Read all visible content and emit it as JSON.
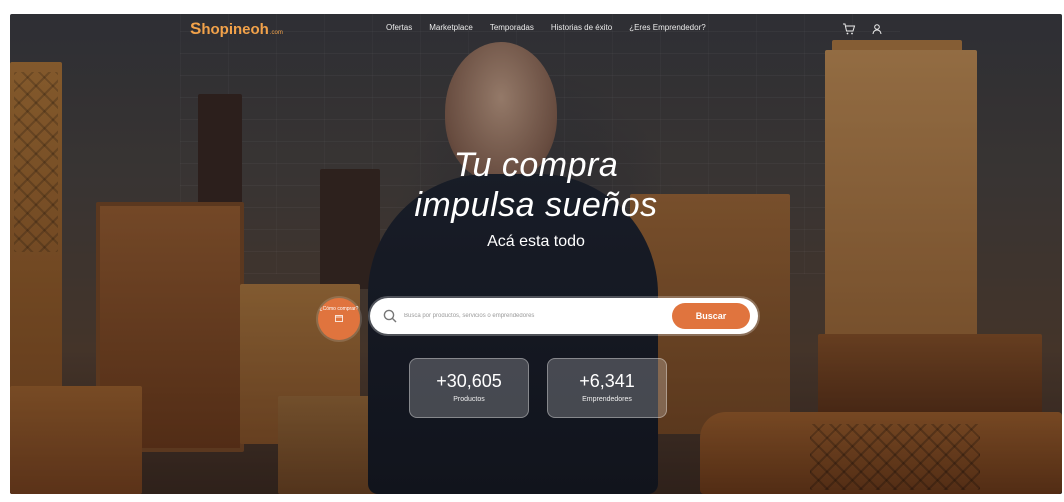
{
  "brand": {
    "logo_mark": "S",
    "logo_text": "hopineoh",
    "logo_tld": ".com"
  },
  "nav": {
    "items": [
      {
        "label": "Ofertas"
      },
      {
        "label": "Marketplace"
      },
      {
        "label": "Temporadas"
      },
      {
        "label": "Historias de éxito"
      },
      {
        "label": "¿Eres Emprendedor?"
      }
    ],
    "icons": {
      "cart": "cart-icon",
      "user": "user-icon"
    }
  },
  "hero": {
    "title_line1": "Tu compra",
    "title_line2": "impulsa sueños",
    "subtitle": "Acá esta todo"
  },
  "promo": {
    "label": "¿Cómo comprar?",
    "icon": "calendar-icon"
  },
  "search": {
    "placeholder": "Busca por productos, servicios o emprendedores",
    "button_label": "Buscar",
    "icon": "search-icon"
  },
  "stats": [
    {
      "value": "+30,605",
      "label": "Productos"
    },
    {
      "value": "+6,341",
      "label": "Emprendedores"
    }
  ],
  "colors": {
    "accent": "#e0743e",
    "logo": "#f2a24a"
  }
}
